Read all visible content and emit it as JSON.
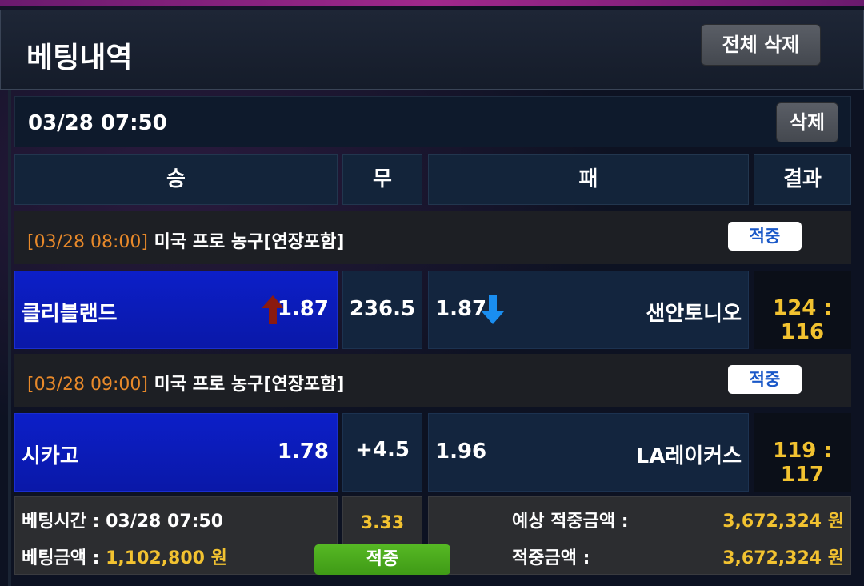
{
  "header": {
    "title": "베팅내역",
    "delete_all_label": "전체 삭제"
  },
  "bet_slip": {
    "date": "03/28 07:50",
    "delete_label": "삭제",
    "columns": [
      "승",
      "무",
      "패",
      "결과"
    ],
    "games": [
      {
        "league_time": "[03/28 08:00]",
        "league_name": "미국 프로 농구[연장포함]",
        "status": "적중",
        "home_team": "클리블랜드",
        "home_odds": "1.87",
        "middle": "236.5",
        "away_odds": "1.87",
        "away_team": "샌안토니오",
        "score": "124 : 116",
        "home_arrow": "up-arrow-icon",
        "away_arrow": "down-arrow-icon"
      },
      {
        "league_time": "[03/28 09:00]",
        "league_name": "미국 프로 농구[연장포함]",
        "status": "적중",
        "home_team": "시카고",
        "home_odds": "1.78",
        "middle": "+4.5",
        "away_odds": "1.96",
        "away_team": "LA레이커스",
        "score": "119 : 117"
      }
    ],
    "summary": {
      "bet_time_label": "베팅시간 :",
      "bet_time_value": "03/28 07:50",
      "bet_amount_label": "베팅금액 :",
      "bet_amount_value": "1,102,800 원",
      "total_odds": "3.33",
      "result_label": "적중",
      "expected_win_label": "예상 적중금액 :",
      "expected_win_value": "3,672,324 원",
      "win_amount_label": "적중금액 :",
      "win_amount_value": "3,672,324 원"
    }
  },
  "colors": {
    "blue_cell": "#0c1fc8",
    "score_yellow": "#f2c230",
    "league_date_orange": "#e8892a",
    "badge_text_blue": "#1a58c8",
    "green_button": "#4caf1f",
    "arrow_up_red": "#8a1a10",
    "arrow_down_blue": "#1a8ef0"
  }
}
